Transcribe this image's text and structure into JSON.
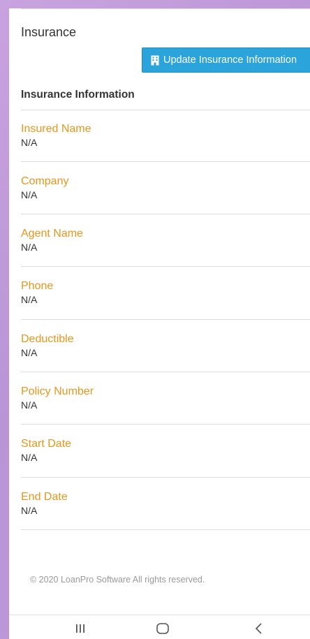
{
  "page": {
    "title": "Insurance"
  },
  "actions": {
    "update_label": "Update Insurance Information"
  },
  "section": {
    "title": "Insurance Information"
  },
  "fields": [
    {
      "label": "Insured Name",
      "value": "N/A"
    },
    {
      "label": "Company",
      "value": "N/A"
    },
    {
      "label": "Agent Name",
      "value": "N/A"
    },
    {
      "label": "Phone",
      "value": "N/A"
    },
    {
      "label": "Deductible",
      "value": "N/A"
    },
    {
      "label": "Policy Number",
      "value": "N/A"
    },
    {
      "label": "Start Date",
      "value": "N/A"
    },
    {
      "label": "End Date",
      "value": "N/A"
    }
  ],
  "footer": {
    "text": "© 2020 LoanPro Software All rights reserved."
  },
  "navbar": {
    "icons": [
      "recent-apps-icon",
      "home-icon",
      "back-icon"
    ]
  },
  "colors": {
    "accent": "#e8961c",
    "button": "#2aa4db",
    "background": "#c9a3de"
  }
}
